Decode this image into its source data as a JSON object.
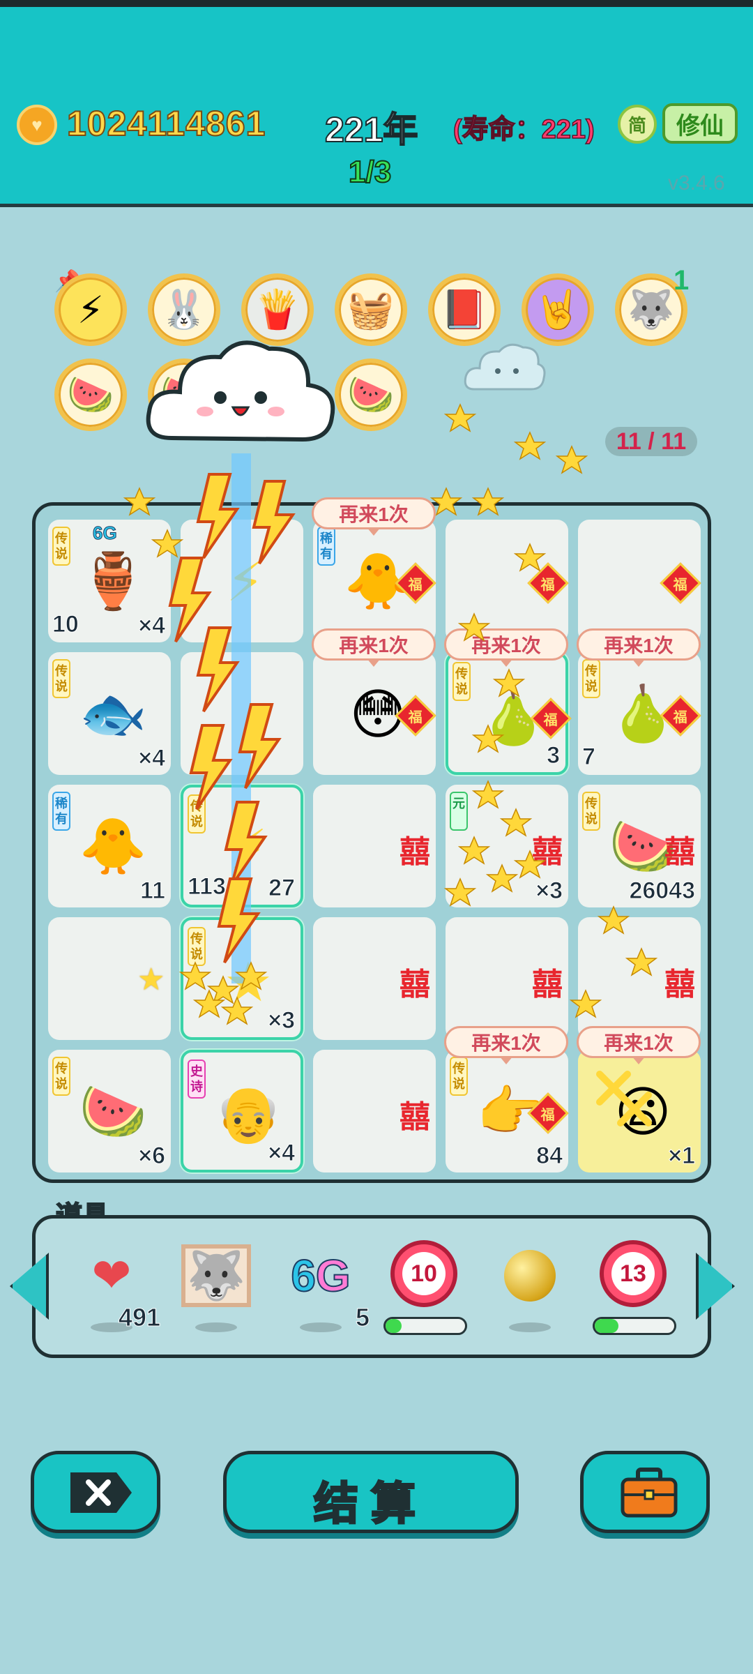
{
  "header": {
    "coins": "1024114861",
    "year": "221年",
    "lifespan": "(寿命：221)",
    "stage": "1/3",
    "simplified_label": "简",
    "xiuxian_label": "修仙",
    "version": "v3.4.6"
  },
  "relics": {
    "count_badge": "1",
    "counter": "11 / 11"
  },
  "board": {
    "bubble": "再来1次",
    "cells": {
      "c00_badge": "6G",
      "c00_left": "10",
      "c00_right": "×4",
      "c10_right": "×4",
      "c20_left": "11",
      "c21_left": "113",
      "c21_right": "27",
      "c31_right": "×3",
      "c40_right": "×6",
      "c41_right": "×4",
      "c13_right": "3",
      "c14_left": "7",
      "c23_right": "×3",
      "c24_right": "26043",
      "c43_right": "84",
      "c44_right": "×1"
    },
    "rarity": {
      "legend": "传说",
      "rare": "稀有",
      "epic": "史诗",
      "yuan": "元"
    },
    "fu": "福",
    "xi": "囍"
  },
  "items": {
    "label": "道具",
    "liver_count": "491",
    "sixg_count": "5",
    "target1": "10",
    "target2": "13",
    "progress1": 0.2,
    "progress2": 0.3
  },
  "actions": {
    "settle": "结算"
  },
  "colors": {
    "teal": "#17c4c6",
    "background": "#a9d6dc",
    "accent_red": "#e8262e",
    "gold": "#ffd84a"
  }
}
